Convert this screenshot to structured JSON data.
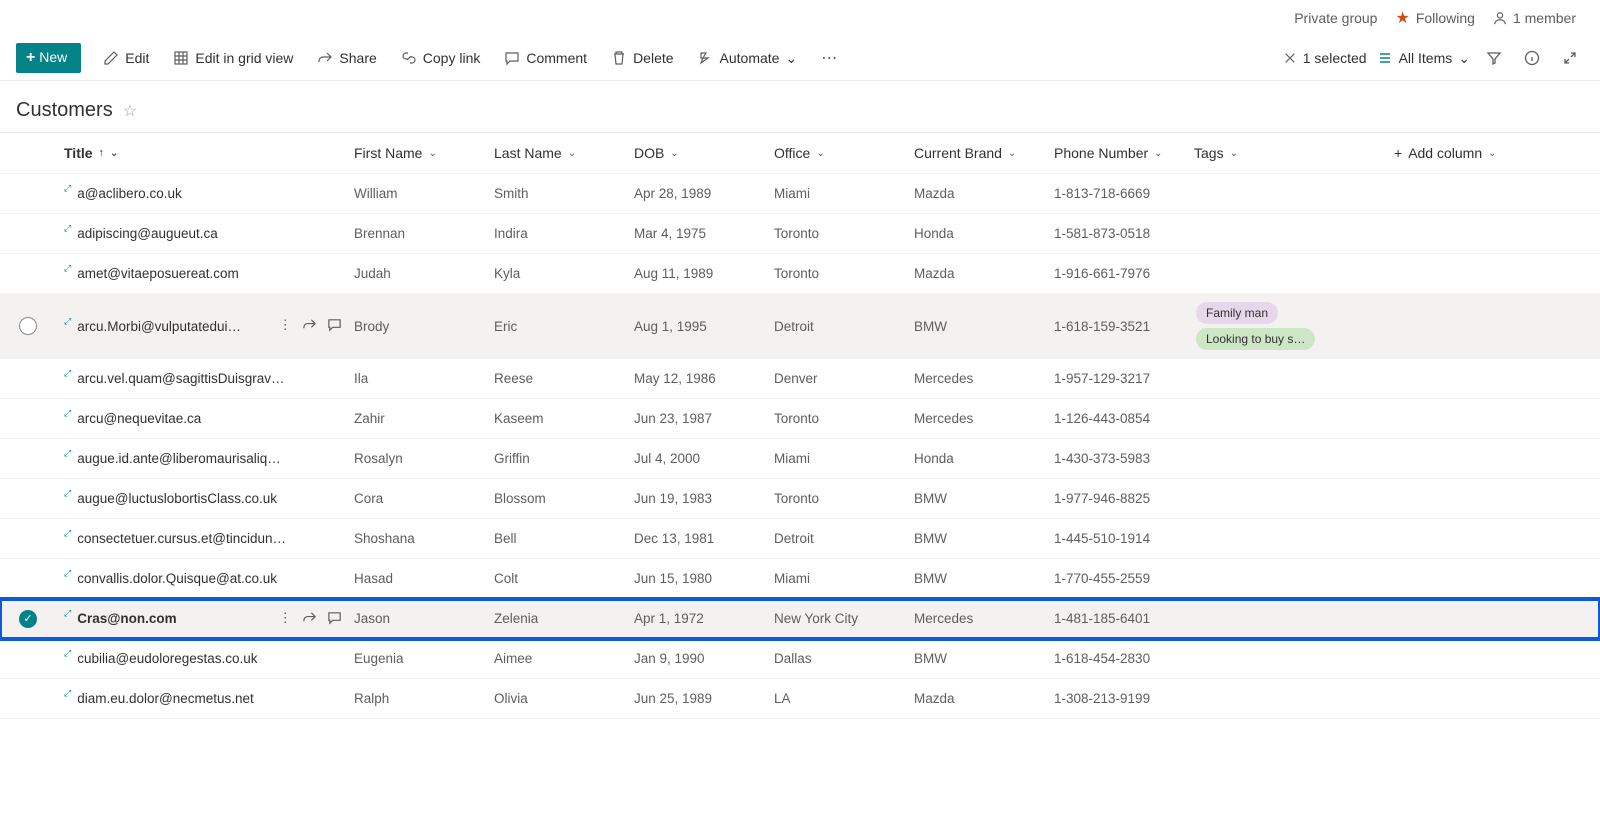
{
  "header": {
    "private_group": "Private group",
    "following": "Following",
    "member_count": "1 member"
  },
  "commands": {
    "new": "New",
    "edit": "Edit",
    "edit_grid": "Edit in grid view",
    "share": "Share",
    "copy_link": "Copy link",
    "comment": "Comment",
    "delete": "Delete",
    "automate": "Automate",
    "selected": "1 selected",
    "all_items": "All Items"
  },
  "list_title": "Customers",
  "columns": {
    "title": "Title",
    "first_name": "First Name",
    "last_name": "Last Name",
    "dob": "DOB",
    "office": "Office",
    "brand": "Current Brand",
    "phone": "Phone Number",
    "tags": "Tags",
    "add_column": "Add column"
  },
  "rows": [
    {
      "title": "a@aclibero.co.uk",
      "first": "William",
      "last": "Smith",
      "dob": "Apr 28, 1989",
      "office": "Miami",
      "brand": "Mazda",
      "phone": "1-813-718-6669",
      "tags": []
    },
    {
      "title": "adipiscing@augueut.ca",
      "first": "Brennan",
      "last": "Indira",
      "dob": "Mar 4, 1975",
      "office": "Toronto",
      "brand": "Honda",
      "phone": "1-581-873-0518",
      "tags": []
    },
    {
      "title": "amet@vitaeposuereat.com",
      "first": "Judah",
      "last": "Kyla",
      "dob": "Aug 11, 1989",
      "office": "Toronto",
      "brand": "Mazda",
      "phone": "1-916-661-7976",
      "tags": []
    },
    {
      "title": "arcu.Morbi@vulputatedui…",
      "first": "Brody",
      "last": "Eric",
      "dob": "Aug 1, 1995",
      "office": "Detroit",
      "brand": "BMW",
      "phone": "1-618-159-3521",
      "tags": [
        "Family man",
        "Looking to buy s…"
      ],
      "hover": true
    },
    {
      "title": "arcu.vel.quam@sagittisDuisgravida.com",
      "first": "Ila",
      "last": "Reese",
      "dob": "May 12, 1986",
      "office": "Denver",
      "brand": "Mercedes",
      "phone": "1-957-129-3217",
      "tags": []
    },
    {
      "title": "arcu@nequevitae.ca",
      "first": "Zahir",
      "last": "Kaseem",
      "dob": "Jun 23, 1987",
      "office": "Toronto",
      "brand": "Mercedes",
      "phone": "1-126-443-0854",
      "tags": []
    },
    {
      "title": "augue.id.ante@liberomaurisaliquam.co.uk",
      "first": "Rosalyn",
      "last": "Griffin",
      "dob": "Jul 4, 2000",
      "office": "Miami",
      "brand": "Honda",
      "phone": "1-430-373-5983",
      "tags": []
    },
    {
      "title": "augue@luctuslobortisClass.co.uk",
      "first": "Cora",
      "last": "Blossom",
      "dob": "Jun 19, 1983",
      "office": "Toronto",
      "brand": "BMW",
      "phone": "1-977-946-8825",
      "tags": []
    },
    {
      "title": "consectetuer.cursus.et@tinciduntDonec.co.uk",
      "first": "Shoshana",
      "last": "Bell",
      "dob": "Dec 13, 1981",
      "office": "Detroit",
      "brand": "BMW",
      "phone": "1-445-510-1914",
      "tags": []
    },
    {
      "title": "convallis.dolor.Quisque@at.co.uk",
      "first": "Hasad",
      "last": "Colt",
      "dob": "Jun 15, 1980",
      "office": "Miami",
      "brand": "BMW",
      "phone": "1-770-455-2559",
      "tags": []
    },
    {
      "title": "Cras@non.com",
      "first": "Jason",
      "last": "Zelenia",
      "dob": "Apr 1, 1972",
      "office": "New York City",
      "brand": "Mercedes",
      "phone": "1-481-185-6401",
      "tags": [],
      "selected": true
    },
    {
      "title": "cubilia@eudoloregestas.co.uk",
      "first": "Eugenia",
      "last": "Aimee",
      "dob": "Jan 9, 1990",
      "office": "Dallas",
      "brand": "BMW",
      "phone": "1-618-454-2830",
      "tags": []
    },
    {
      "title": "diam.eu.dolor@necmetus.net",
      "first": "Ralph",
      "last": "Olivia",
      "dob": "Jun 25, 1989",
      "office": "LA",
      "brand": "Mazda",
      "phone": "1-308-213-9199",
      "tags": []
    }
  ]
}
